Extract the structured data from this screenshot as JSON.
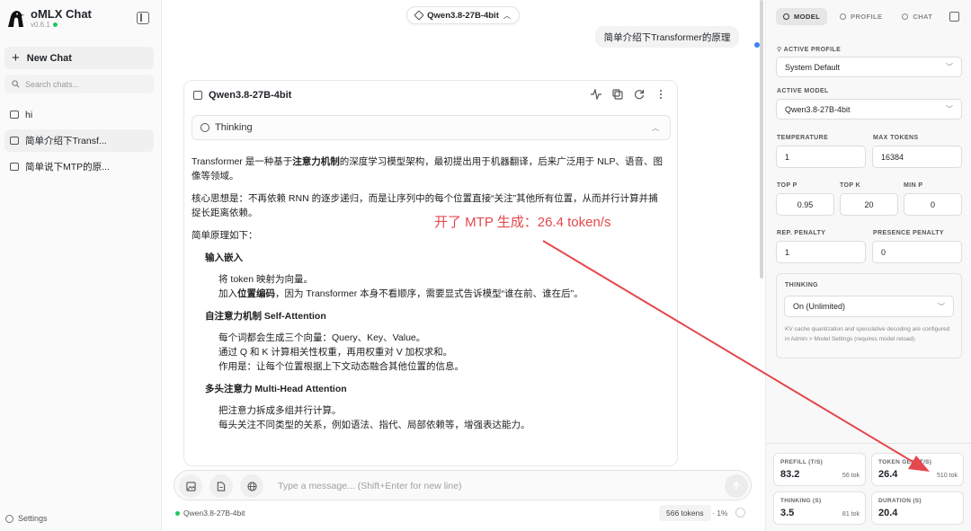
{
  "colors": {
    "accent": "#e5484d",
    "status_green": "#22c55e",
    "scroll_blue": "#3b82f6"
  },
  "sidebar": {
    "app_title": "oMLX Chat",
    "version": "v0.6.1",
    "new_chat_label": "New Chat",
    "search_placeholder": "Search chats...",
    "chats": [
      {
        "label": "hi",
        "active": false
      },
      {
        "label": "简单介绍下Transf...",
        "active": true
      },
      {
        "label": "简单说下MTP的原...",
        "active": false
      }
    ],
    "settings_label": "Settings"
  },
  "header": {
    "model_pill": "Qwen3.8-27B-4bit"
  },
  "conversation": {
    "user_message": "简单介绍下Transformer的原理",
    "assistant_model": "Qwen3.8-27B-4bit",
    "thinking_label": "Thinking",
    "p1_a": "Transformer 是一种基于",
    "p1_b": "注意力机制",
    "p1_c": "的深度学习模型架构，最初提出用于机器翻译，后来广泛用于 NLP、语音、图像等领域。",
    "p2": "核心思想是：不再依赖 RNN 的逐步递归，而是让序列中的每个位置直接“关注”其他所有位置，从而并行计算并捕捉长距离依赖。",
    "p3": "简单原理如下：",
    "s1_title": "输入嵌入",
    "s1_l1": "将 token 映射为向量。",
    "s1_l2_a": "加入",
    "s1_l2_b": "位置编码",
    "s1_l2_c": "，因为 Transformer 本身不看顺序，需要显式告诉模型“谁在前、谁在后”。",
    "s2_title": "自注意力机制 Self-Attention",
    "s2_l1": "每个词都会生成三个向量：Query、Key、Value。",
    "s2_l2": "通过 Q 和 K 计算相关性权重，再用权重对 V 加权求和。",
    "s2_l3": "作用是：让每个位置根据上下文动态融合其他位置的信息。",
    "s3_title": "多头注意力 Multi-Head Attention",
    "s3_l1": "把注意力拆成多组并行计算。",
    "s3_l2": "每头关注不同类型的关系，例如语法、指代、局部依赖等，增强表达能力。"
  },
  "annotation": "开了 MTP 生成：26.4 token/s",
  "composer": {
    "placeholder": "Type a message... (Shift+Enter for new line)",
    "footer_model": "Qwen3.8-27B-4bit",
    "token_count": "566 tokens",
    "context_pct": "1%"
  },
  "panel": {
    "tabs": [
      "MODEL",
      "PROFILE",
      "CHAT"
    ],
    "active_profile_label": "ACTIVE PROFILE",
    "active_profile_value": "System Default",
    "active_model_label": "ACTIVE MODEL",
    "active_model_value": "Qwen3.8-27B-4bit",
    "temperature_label": "TEMPERATURE",
    "temperature_value": "1",
    "max_tokens_label": "MAX TOKENS",
    "max_tokens_value": "16384",
    "top_p_label": "TOP P",
    "top_p_value": "0.95",
    "top_k_label": "TOP K",
    "top_k_value": "20",
    "min_p_label": "MIN P",
    "min_p_value": "0",
    "rep_penalty_label": "REP. PENALTY",
    "rep_penalty_value": "1",
    "presence_penalty_label": "PRESENCE PENALTY",
    "presence_penalty_value": "0",
    "thinking_label": "THINKING",
    "thinking_value": "On (Unlimited)",
    "note": "KV cache quantization and speculative decoding are configured in Admin > Model Settings (requires model reload)."
  },
  "stats": {
    "prefill_label": "PREFILL (T/S)",
    "prefill_value": "83.2",
    "prefill_sub": "56 tok",
    "gen_label": "TOKEN GEN (T/S)",
    "gen_value": "26.4",
    "gen_sub": "510 tok",
    "thinking_label": "THINKING (S)",
    "thinking_value": "3.5",
    "thinking_sub": "81 tok",
    "duration_label": "DURATION (S)",
    "duration_value": "20.4"
  }
}
